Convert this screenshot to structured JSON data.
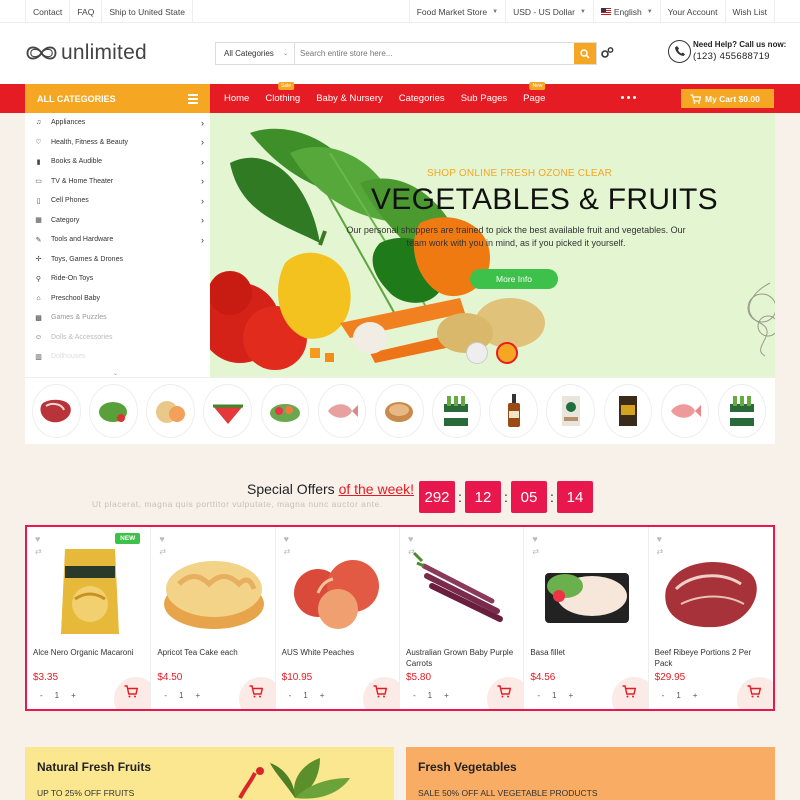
{
  "topbar": {
    "left": [
      "Contact",
      "FAQ",
      "Ship to United State"
    ],
    "store": "Food Market Store",
    "currency": "USD - US Dollar",
    "language": "English",
    "account": "Your Account",
    "wishlist": "Wish List"
  },
  "header": {
    "logo": "unlimited",
    "search_category": "All Categories",
    "search_placeholder": "Search entire store here...",
    "help_title": "Need Help? Call us now:",
    "help_phone": "(123) 455688719"
  },
  "nav": {
    "all_categories": "ALL CATEGORIES",
    "items": [
      {
        "label": "Home",
        "tag": ""
      },
      {
        "label": "Clothing",
        "tag": "Sale",
        "tag_color": "#f5a623"
      },
      {
        "label": "Baby & Nursery",
        "tag": ""
      },
      {
        "label": "Categories",
        "tag": ""
      },
      {
        "label": "Sub Pages",
        "tag": ""
      },
      {
        "label": "Page",
        "tag": "New",
        "tag_color": "#f5a623"
      }
    ],
    "cart": "My Cart $0.00"
  },
  "sidebar": {
    "items": [
      {
        "label": "Appliances",
        "icon": "music-note-icon",
        "arrow": true
      },
      {
        "label": "Health, Fitness & Beauty",
        "icon": "heart-icon",
        "arrow": true
      },
      {
        "label": "Books & Audible",
        "icon": "book-icon",
        "arrow": true
      },
      {
        "label": "TV & Home Theater",
        "icon": "tv-icon",
        "arrow": true
      },
      {
        "label": "Cell Phones",
        "icon": "phone-icon",
        "arrow": true
      },
      {
        "label": "Category",
        "icon": "keyboard-icon",
        "arrow": true
      },
      {
        "label": "Tools and Hardware",
        "icon": "wrench-icon",
        "arrow": true
      },
      {
        "label": "Toys, Games & Drones",
        "icon": "drone-icon",
        "arrow": false
      },
      {
        "label": "Ride-On Toys",
        "icon": "ride-icon",
        "arrow": false
      },
      {
        "label": "Preschool Baby",
        "icon": "bell-icon",
        "arrow": false
      },
      {
        "label": "Games & Puzzles",
        "icon": "puzzle-icon",
        "arrow": false
      },
      {
        "label": "Dolls & Accessories",
        "icon": "doll-icon",
        "arrow": false
      },
      {
        "label": "Dollhouses",
        "icon": "house-icon",
        "arrow": false
      }
    ]
  },
  "hero": {
    "eyebrow": "SHOP ONLINE FRESH OZONE CLEAR",
    "title": "VEGETABLES & FRUITS",
    "description": "Our personal shoppers are trained to pick the best available fruit and vegetables. Our team work with you in mind, as if you picked it yourself.",
    "button": "More Info"
  },
  "special_offers": {
    "title": "Special Offers",
    "title_highlight": "of the week!",
    "subtitle": "Ut placerat, magna quis porttitor vulputate, magna nunc auctor ante.",
    "timer": [
      "292",
      "12",
      "05",
      "14"
    ]
  },
  "products": [
    {
      "name": "Alce Nero Organic Macaroni",
      "price": "$3.35",
      "qty": "1",
      "badge": "NEW"
    },
    {
      "name": "Apricot Tea Cake each",
      "price": "$4.50",
      "qty": "1",
      "badge": ""
    },
    {
      "name": "AUS White Peaches",
      "price": "$10.95",
      "qty": "1",
      "badge": ""
    },
    {
      "name": "Australian Grown Baby Purple Carrots",
      "price": "$5.80",
      "qty": "1",
      "badge": ""
    },
    {
      "name": "Basa fillet",
      "price": "$4.56",
      "qty": "1",
      "badge": ""
    },
    {
      "name": "Beef Ribeye Portions 2 Per Pack",
      "price": "$29.95",
      "qty": "1",
      "badge": ""
    }
  ],
  "banners": [
    {
      "title": "Natural Fresh Fruits",
      "subtitle": "UP TO 25% OFF FRUITS"
    },
    {
      "title": "Fresh Vegetables",
      "subtitle": "SALE 50% OFF ALL VEGETABLE PRODUCTS"
    }
  ],
  "colors": {
    "primary_red": "#e51c23",
    "accent_orange": "#f5a623",
    "green": "#3ec14a",
    "timer_pink": "#e8174d"
  }
}
